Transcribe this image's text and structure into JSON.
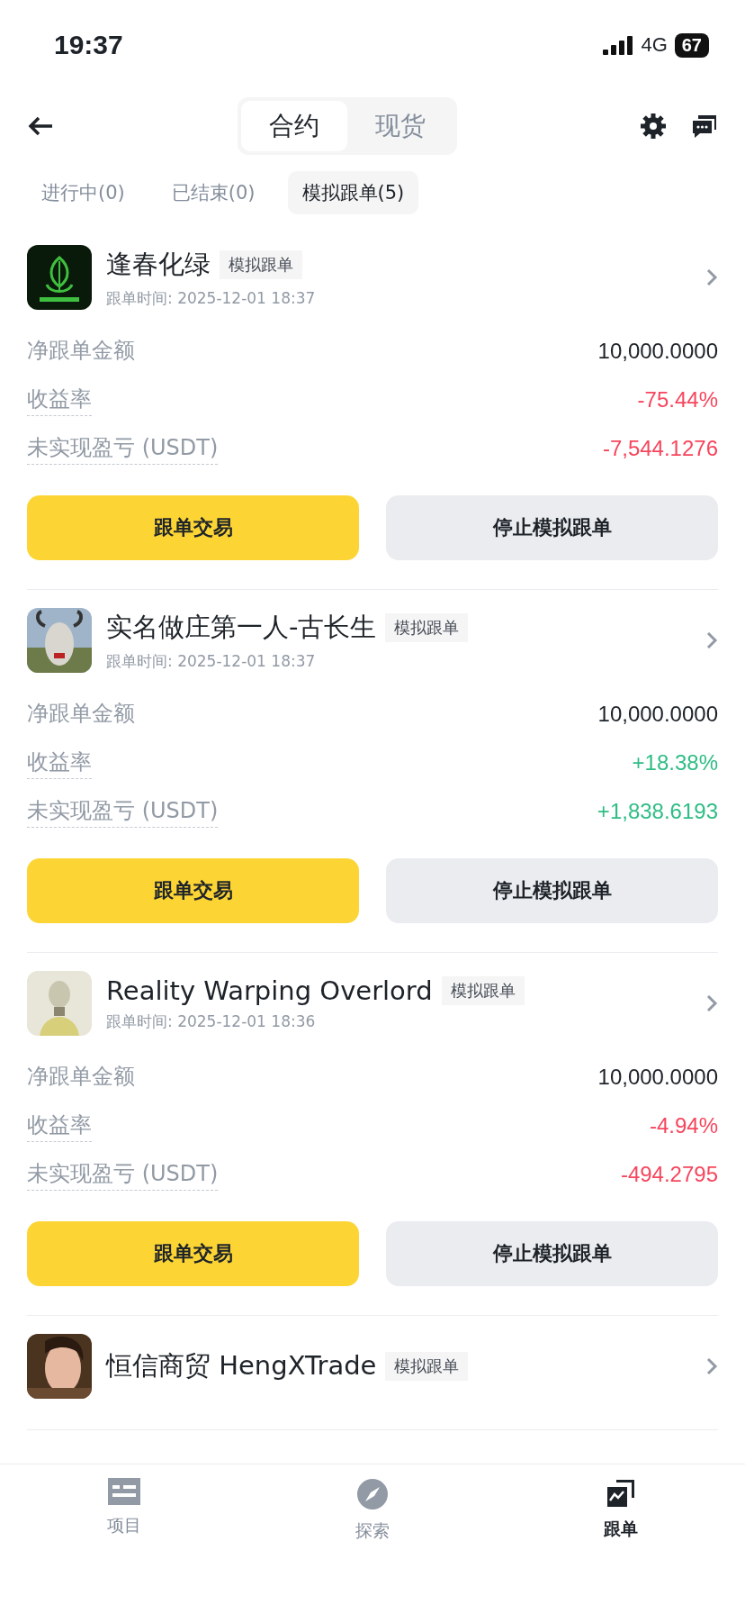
{
  "status_bar": {
    "time": "19:37",
    "network": "4G",
    "battery": "67"
  },
  "header": {
    "segments": [
      {
        "label": "合约",
        "selected": true
      },
      {
        "label": "现货",
        "selected": false
      }
    ]
  },
  "filter_tabs": [
    {
      "label": "进行中(0)",
      "selected": false
    },
    {
      "label": "已结束(0)",
      "selected": false
    },
    {
      "label": "模拟跟单(5)",
      "selected": true
    }
  ],
  "traders": [
    {
      "name": "逢春化绿",
      "badge": "模拟跟单",
      "time": "跟单时间: 2025-12-01 18:37",
      "avatar": {
        "kind": "picture"
      },
      "stats": [
        {
          "label": "净跟单金额",
          "underlined": false,
          "value": "10,000.0000",
          "kind": "neutral"
        },
        {
          "label": "收益率",
          "underlined": true,
          "value": "-75.44%",
          "kind": "loss"
        },
        {
          "label": "未实现盈亏 (USDT)",
          "underlined": true,
          "value": "-7,544.1276",
          "kind": "loss"
        }
      ],
      "buttons": [
        "跟单交易",
        "停止模拟跟单"
      ]
    },
    {
      "name": "实名做庄第一人-古长生",
      "badge": "模拟跟单",
      "time": "跟单时间: 2025-12-01 18:37",
      "avatar": {
        "kind": "picture"
      },
      "stats": [
        {
          "label": "净跟单金额",
          "underlined": false,
          "value": "10,000.0000",
          "kind": "neutral"
        },
        {
          "label": "收益率",
          "underlined": true,
          "value": "+18.38%",
          "kind": "gain"
        },
        {
          "label": "未实现盈亏 (USDT)",
          "underlined": true,
          "value": "+1,838.6193",
          "kind": "gain"
        }
      ],
      "buttons": [
        "跟单交易",
        "停止模拟跟单"
      ]
    },
    {
      "name": "Reality Warping Overlord",
      "badge": "模拟跟单",
      "time": "跟单时间: 2025-12-01 18:36",
      "avatar": {
        "kind": "picture"
      },
      "stats": [
        {
          "label": "净跟单金额",
          "underlined": false,
          "value": "10,000.0000",
          "kind": "neutral"
        },
        {
          "label": "收益率",
          "underlined": true,
          "value": "-4.94%",
          "kind": "loss"
        },
        {
          "label": "未实现盈亏 (USDT)",
          "underlined": true,
          "value": "-494.2795",
          "kind": "loss"
        }
      ],
      "buttons": [
        "跟单交易",
        "停止模拟跟单"
      ]
    },
    {
      "name": "恒信商贸 HengXTrade",
      "badge": "模拟跟单",
      "avatar": {
        "kind": "picture"
      }
    }
  ],
  "bottom_nav": [
    {
      "label": "项目",
      "kind": "projects",
      "selected": false
    },
    {
      "label": "探索",
      "kind": "explore",
      "selected": false
    },
    {
      "label": "跟单",
      "kind": "copy",
      "selected": true
    }
  ]
}
